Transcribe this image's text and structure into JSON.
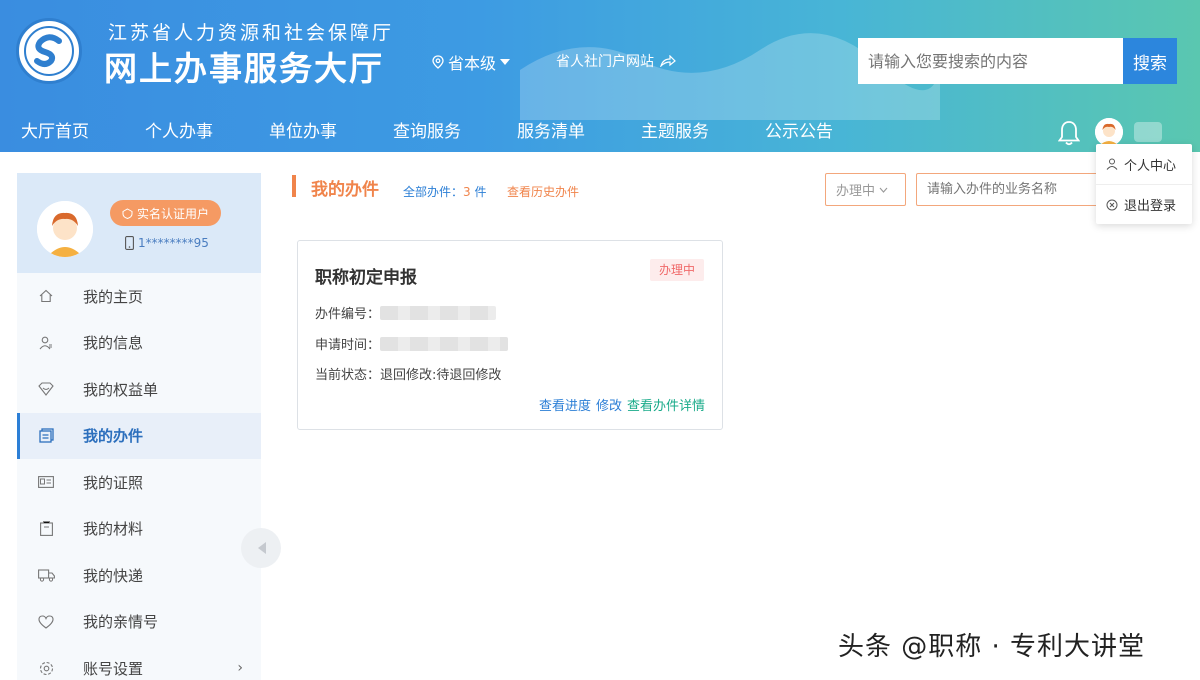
{
  "header": {
    "subtitle": "江苏省人力资源和社会保障厅",
    "title": "网上办事服务大厅",
    "region": "省本级",
    "portal_link": "省人社门户网站",
    "search": {
      "placeholder": "请输入您要搜索的内容",
      "button": "搜索"
    }
  },
  "nav": [
    "大厅首页",
    "个人办事",
    "单位办事",
    "查询服务",
    "服务清单",
    "主题服务",
    "公示公告"
  ],
  "user_menu": {
    "items": [
      "个人中心",
      "退出登录"
    ]
  },
  "sidebar": {
    "badge": "实名认证用户",
    "phone": "1********95",
    "items": [
      {
        "label": "我的主页",
        "icon": "home-icon"
      },
      {
        "label": "我的信息",
        "icon": "user-icon"
      },
      {
        "label": "我的权益单",
        "icon": "heart-shield-icon"
      },
      {
        "label": "我的办件",
        "icon": "files-icon",
        "active": true
      },
      {
        "label": "我的证照",
        "icon": "id-card-icon"
      },
      {
        "label": "我的材料",
        "icon": "folder-icon"
      },
      {
        "label": "我的快递",
        "icon": "truck-icon"
      },
      {
        "label": "我的亲情号",
        "icon": "family-icon"
      },
      {
        "label": "账号设置",
        "icon": "gear-icon",
        "arrow": "›"
      }
    ]
  },
  "content": {
    "section_title": "我的办件",
    "all_label": "全部办件：",
    "all_count": "3",
    "all_unit": "件",
    "history_link": "查看历史办件",
    "status_filter": "办理中",
    "name_placeholder": "请输入办件的业务名称",
    "card": {
      "title": "职称初定申报",
      "status": "办理中",
      "number_label": "办件编号：",
      "time_label": "申请时间：",
      "state_label": "当前状态：",
      "state_value": "退回修改:待退回修改",
      "link_progress": "查看进度",
      "link_edit": "修改",
      "link_detail": "查看办件详情"
    }
  },
  "watermark": "头条 @职称 · 专利大讲堂",
  "colors": {
    "primary": "#2c7fd6",
    "accent": "#f0844b",
    "status_red": "#f06a6a",
    "teal": "#1aab8a"
  }
}
